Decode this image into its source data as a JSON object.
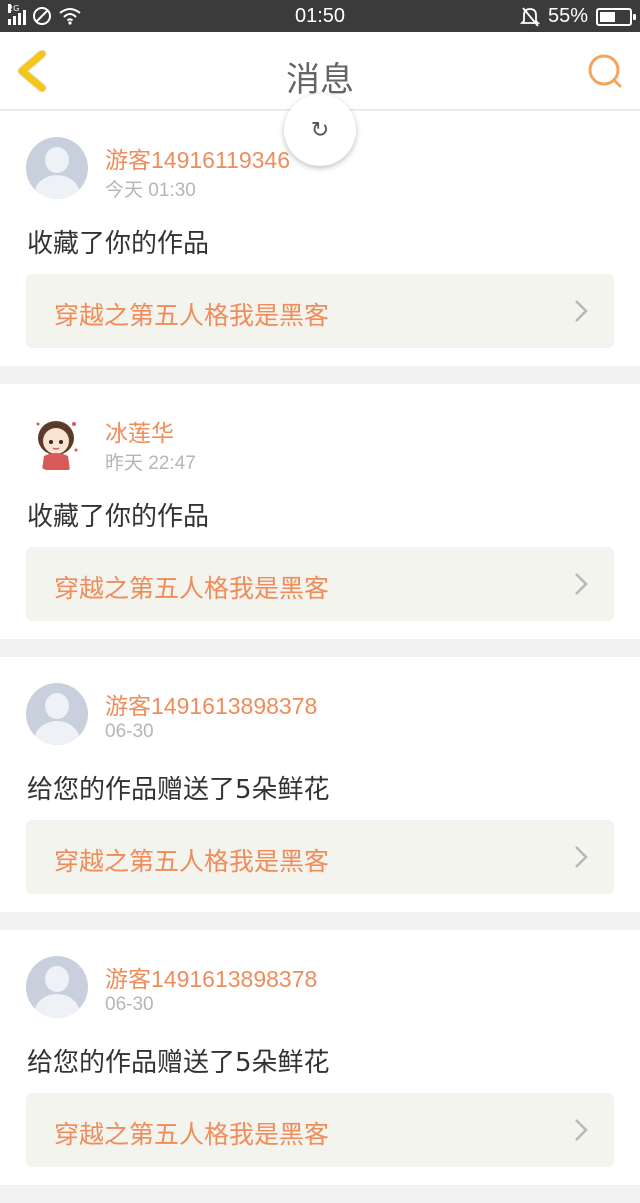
{
  "status": {
    "network_tag": "2G",
    "time": "01:50",
    "battery_percent_text": "55%",
    "battery_level": 0.55
  },
  "nav": {
    "title": "消息"
  },
  "refresh": {
    "glyph": "↻"
  },
  "messages": [
    {
      "user": "游客14916119346",
      "time": "今天 01:30",
      "action": "收藏了你的作品",
      "work": "穿越之第五人格我是黑客",
      "avatar": "default-avatar"
    },
    {
      "user": "冰莲华",
      "time": "昨天 22:47",
      "action": "收藏了你的作品",
      "work": "穿越之第五人格我是黑客",
      "avatar": "anime-girl-avatar"
    },
    {
      "user": "游客1491613898378",
      "time": "06-30",
      "action": "给您的作品赠送了5朵鲜花",
      "work": "穿越之第五人格我是黑客",
      "avatar": "default-avatar"
    },
    {
      "user": "游客1491613898378",
      "time": "06-30",
      "action": "给您的作品赠送了5朵鲜花",
      "work": "穿越之第五人格我是黑客",
      "avatar": "default-avatar"
    }
  ],
  "colors": {
    "accent": "#ef8c5a",
    "back_arrow": "#f5c518",
    "search": "#f5a55a"
  }
}
